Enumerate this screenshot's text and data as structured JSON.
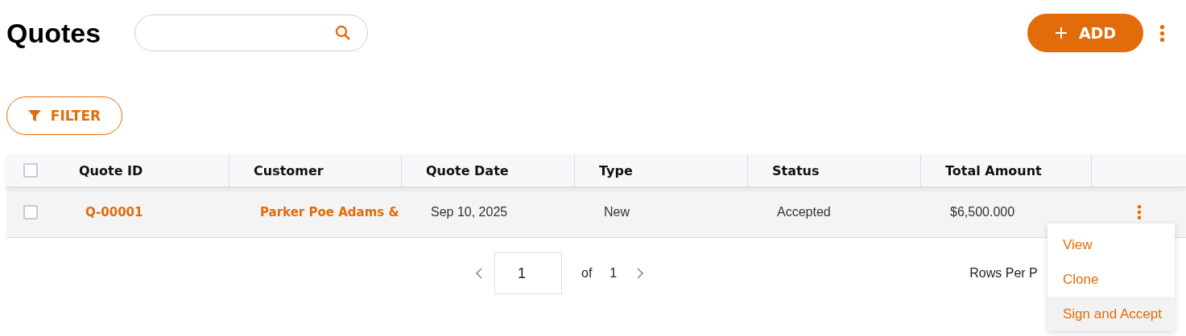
{
  "page_title": "Quotes",
  "add_button": {
    "label": "ADD"
  },
  "filter_button": {
    "label": "FILTER"
  },
  "table": {
    "header_checked": false,
    "columns": [
      "Quote ID",
      "Customer",
      "Quote Date",
      "Type",
      "Status",
      "Total Amount"
    ],
    "rows": [
      {
        "checked": false,
        "cells": [
          "Q-00001",
          "Parker Poe Adams &",
          "Sep 10, 2025",
          "New",
          "Accepted",
          "$6,500.000"
        ]
      }
    ]
  },
  "pagination": {
    "page": "1",
    "of_label": "of",
    "total": "1",
    "rows_per_page_label": "Rows Per P"
  },
  "row_menu": {
    "items": [
      {
        "label": "View",
        "selected": false
      },
      {
        "label": "Clone",
        "selected": false
      },
      {
        "label": "Sign and Accept",
        "selected": true
      }
    ]
  }
}
